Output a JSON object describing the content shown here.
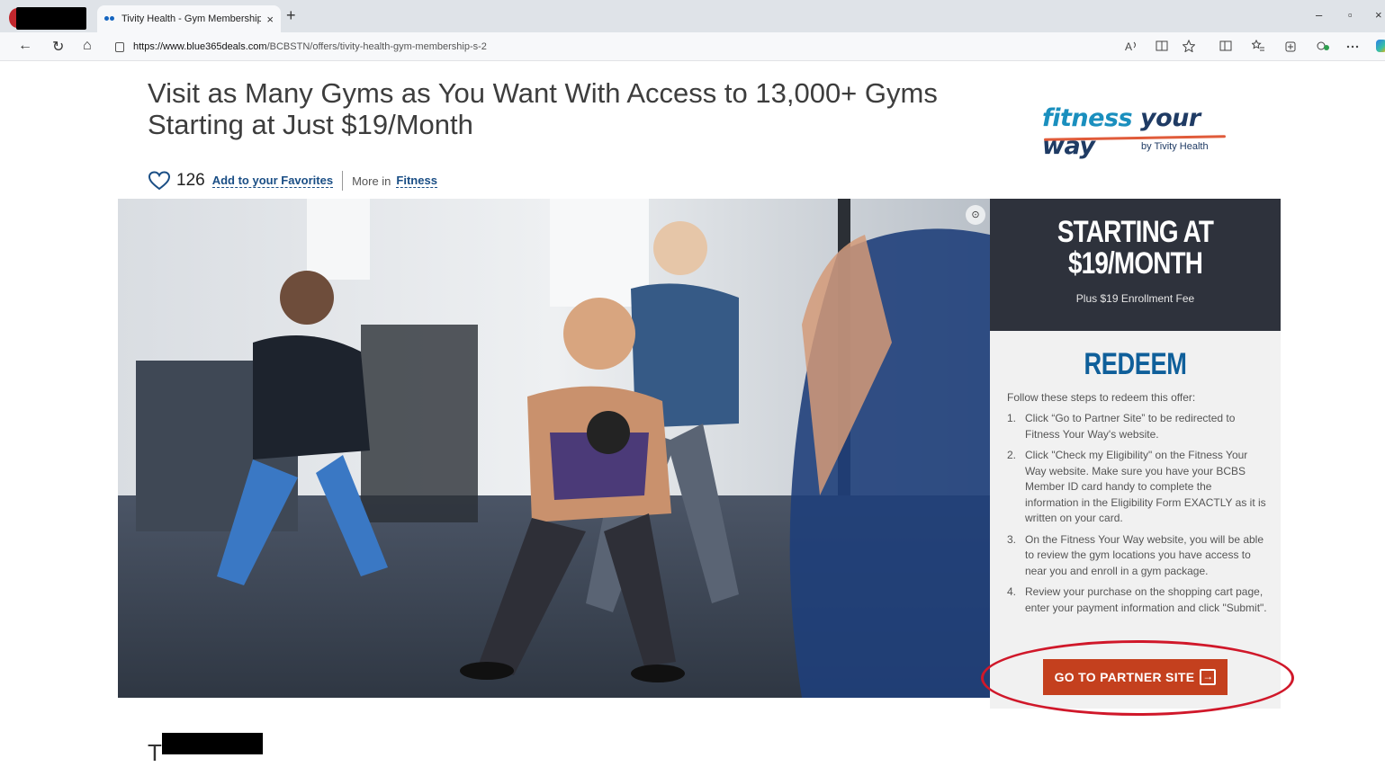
{
  "browser": {
    "tab_title": "Tivity Health - Gym Membership",
    "tab_close": "×",
    "new_tab": "+",
    "url_host": "https://www.blue365deals.com",
    "url_path": "/BCBSTN/offers/tivity-health-gym-membership-s-2",
    "window": {
      "minimize": "–",
      "restore": "▫",
      "close": "×"
    },
    "nav": {
      "back": "←",
      "refresh": "↻",
      "home": "⌂"
    },
    "toolbar_icons": [
      "read-aloud-icon",
      "immersive-reader-icon",
      "favorite-star-icon",
      "split-screen-icon",
      "favorites-icon",
      "collections-icon",
      "extensions-icon",
      "more-icon"
    ]
  },
  "offer": {
    "headline": "Visit as Many Gyms as You Want With Access to 13,000+ Gyms Starting at Just $19/Month",
    "logo_word1": "fitness",
    "logo_word2": "your way",
    "logo_by": "by Tivity Health",
    "favorites_count": "126",
    "add_favorites": "Add to your Favorites",
    "more_in": "More in",
    "category": "Fitness"
  },
  "panel": {
    "price": "STARTING AT $19/MONTH",
    "fee": "Plus $19 Enrollment Fee",
    "redeem_title": "REDEEM",
    "steps_intro": "Follow these steps to redeem this offer:",
    "steps": [
      {
        "num": "1.",
        "text": "Click “Go to Partner Site” to be redirected to Fitness Your Way's website."
      },
      {
        "num": "2.",
        "text": "Click \"Check my Eligibility\" on the Fitness Your Way website. Make sure you have your BCBS Member ID card handy to complete the information in the Eligibility Form EXACTLY as it is written on your card."
      },
      {
        "num": "3.",
        "text": "On the Fitness Your Way website, you will be able to review the gym locations you have access to near you and enroll in a gym package."
      },
      {
        "num": "4.",
        "text": "Review your purchase on the shopping cart page, enter your payment information and click \"Submit\"."
      }
    ],
    "cta": "GO TO PARTNER SITE",
    "cta_icon": "→"
  },
  "bottom": {
    "letter": "T"
  },
  "colors": {
    "accent_blue": "#1a4e85",
    "redeem_blue": "#0f5f9a",
    "cta_orange": "#c4401e",
    "panel_dark": "#2e323c",
    "annotation_red": "#d0182a"
  }
}
